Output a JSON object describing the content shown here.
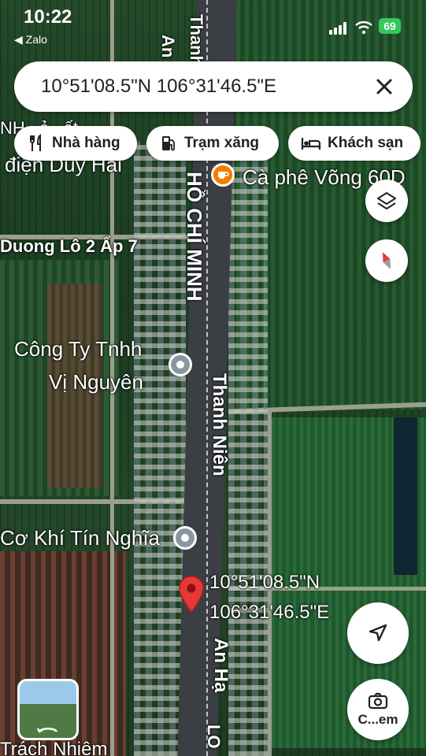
{
  "status": {
    "time": "10:22",
    "back_app": "◀ Zalo",
    "battery": "69"
  },
  "search": {
    "query": "10°51'08.5\"N 106°31'46.5\"E"
  },
  "chips": [
    {
      "label": "Nhà hàng",
      "icon": "restaurant-icon"
    },
    {
      "label": "Trạm xăng",
      "icon": "gas-station-icon"
    },
    {
      "label": "Khách sạn",
      "icon": "hotel-icon"
    }
  ],
  "map": {
    "places": {
      "top_left": "điện Duy Hải",
      "top_left_partial": "NH...ả...ất",
      "cafe": "Cà phê Võng 60D",
      "company_line1": "Công Ty Tnhh",
      "company_line2": "Vị Nguyên",
      "mechanic": "Cơ Khí Tín Nghĩa",
      "bottom_left": "Trách Nhiệm"
    },
    "streets": {
      "duong_lo": "Duong Lô 2 Ấp 7",
      "ho_chi_minh": "HỒ CHÍ MINH",
      "thanh_nien_top": "Thanh",
      "thanh_nien": "Thanh Niên",
      "an_ha": "An Hạ",
      "an_top": "An",
      "lo_bottom": "LO"
    },
    "pin": {
      "line1": "10°51'08.5\"N",
      "line2": "106°31'46.5\"E",
      "color": "#e53935"
    }
  },
  "controls": {
    "camera_label": "C...em"
  }
}
